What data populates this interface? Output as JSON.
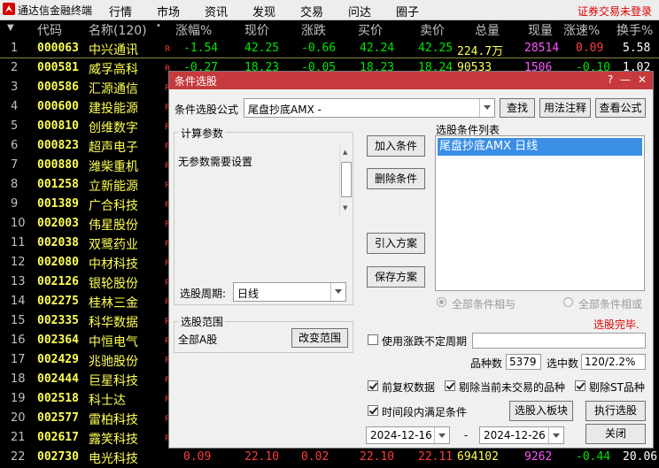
{
  "app": {
    "title": "通达信金融终端",
    "login_link": "证券交易未登录"
  },
  "menu": [
    "行情",
    "市场",
    "资讯",
    "发现",
    "交易",
    "问达",
    "圈子"
  ],
  "table": {
    "headers": [
      "代码",
      "名称(120)",
      "涨幅%",
      "现价",
      "涨跌",
      "买价",
      "卖价",
      "总量",
      "现量",
      "涨速%",
      "换手%"
    ],
    "rows": [
      {
        "idx": "1",
        "code": "000063",
        "name": "中兴通讯",
        "flag": "R",
        "pct": "-1.54",
        "price": "42.25",
        "chg": "-0.66",
        "bid": "42.24",
        "ask": "42.25",
        "vol": "224.7万",
        "cur": "28514",
        "spd": "0.09",
        "turn": "5.58"
      },
      {
        "idx": "2",
        "code": "000581",
        "name": "威孚高科",
        "flag": "R",
        "pct": "-0.27",
        "price": "18.23",
        "chg": "-0.05",
        "bid": "18.23",
        "ask": "18.24",
        "vol": "90533",
        "cur": "1506",
        "spd": "-0.10",
        "turn": "1.02"
      },
      {
        "idx": "3",
        "code": "000586",
        "name": "汇源通信",
        "flag": "R"
      },
      {
        "idx": "4",
        "code": "000600",
        "name": "建投能源",
        "flag": "R"
      },
      {
        "idx": "5",
        "code": "000810",
        "name": "创维数字",
        "flag": "R"
      },
      {
        "idx": "6",
        "code": "000823",
        "name": "超声电子",
        "flag": "R"
      },
      {
        "idx": "7",
        "code": "000880",
        "name": "潍柴重机",
        "flag": "R"
      },
      {
        "idx": "8",
        "code": "001258",
        "name": "立新能源",
        "flag": "R"
      },
      {
        "idx": "9",
        "code": "001389",
        "name": "广合科技",
        "flag": "R"
      },
      {
        "idx": "10",
        "code": "002003",
        "name": "伟星股份",
        "flag": "R"
      },
      {
        "idx": "11",
        "code": "002038",
        "name": "双鹭药业",
        "flag": "R"
      },
      {
        "idx": "12",
        "code": "002080",
        "name": "中材科技",
        "flag": "R"
      },
      {
        "idx": "13",
        "code": "002126",
        "name": "银轮股份",
        "flag": "R"
      },
      {
        "idx": "14",
        "code": "002275",
        "name": "桂林三金",
        "flag": "R"
      },
      {
        "idx": "15",
        "code": "002335",
        "name": "科华数据",
        "flag": "R"
      },
      {
        "idx": "16",
        "code": "002364",
        "name": "中恒电气",
        "flag": "R"
      },
      {
        "idx": "17",
        "code": "002429",
        "name": "兆驰股份",
        "flag": "R"
      },
      {
        "idx": "18",
        "code": "002444",
        "name": "巨星科技",
        "flag": "R"
      },
      {
        "idx": "19",
        "code": "002518",
        "name": "科士达",
        "flag": "R"
      },
      {
        "idx": "20",
        "code": "002577",
        "name": "雷柏科技",
        "flag": "R"
      },
      {
        "idx": "21",
        "code": "002617",
        "name": "露笑科技",
        "flag": "R"
      },
      {
        "idx": "22",
        "code": "002730",
        "name": "电光科技",
        "flag": "",
        "pct": "0.09",
        "price": "22.10",
        "chg": "0.02",
        "bid": "22.10",
        "ask": "22.11",
        "vol": "694102",
        "cur": "9262",
        "spd": "-0.44",
        "turn": "20.06"
      }
    ]
  },
  "dialog": {
    "title": "条件选股",
    "formula_label": "条件选股公式",
    "formula_value": "尾盘抄底AMX  -",
    "btn_find": "查找",
    "btn_usage": "用法注释",
    "btn_view": "查看公式",
    "params_title": "计算参数",
    "params_text": "无参数需要设置",
    "period_label": "选股周期:",
    "period_value": "日线",
    "btn_add": "加入条件",
    "btn_delete": "删除条件",
    "btn_import": "引入方案",
    "btn_save": "保存方案",
    "cond_list_title": "选股条件列表",
    "cond_items": [
      "尾盘抄底AMX  日线"
    ],
    "radio_and": "全部条件相与",
    "radio_or": "全部条件相或",
    "status": "选股完毕.",
    "range_title": "选股范围",
    "range_value": "全部A股",
    "btn_change_range": "改变范围",
    "chk_uncertain": "使用涨跌不定周期",
    "count_label": "品种数",
    "count_value": "5379",
    "selected_label": "选中数",
    "selected_value": "120/2.2%",
    "chk_fq": "前复权数据",
    "chk_remove_untraded": "剔除当前未交易的品种",
    "chk_remove_st": "剔除ST品种",
    "chk_period": "时间段内满足条件",
    "btn_to_block": "选股入板块",
    "btn_execute": "执行选股",
    "date_from": "2024-12-16",
    "date_sep": "-",
    "date_to": "2024-12-26",
    "btn_close": "关闭",
    "colors": {
      "titlebar": "#c63a3d",
      "status": "#e00000"
    }
  }
}
